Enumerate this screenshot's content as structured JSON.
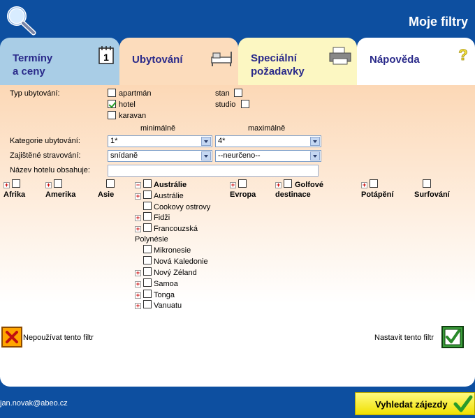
{
  "header": {
    "title": "Moje filtry",
    "logo_icon": "magnifier-icon"
  },
  "tabs": [
    {
      "label_line1": "Termíny",
      "label_line2": "a ceny",
      "icon": "calendar-icon",
      "color": "#a9cde6"
    },
    {
      "label_line1": "Ubytování",
      "label_line2": "",
      "icon": "bed-icon",
      "color": "#fcdcbc",
      "active": true
    },
    {
      "label_line1": "Speciální",
      "label_line2": "požadavky",
      "icon": "printer-icon",
      "color": "#fcf7c2"
    },
    {
      "label_line1": "Nápověda",
      "label_line2": "",
      "icon": "question-icon",
      "color": "#ffffff"
    }
  ],
  "form": {
    "typ_label": "Typ ubytování:",
    "typ_options": [
      {
        "label": "apartmán",
        "checked": false
      },
      {
        "label": "hotel",
        "checked": true
      },
      {
        "label": "karavan",
        "checked": false
      },
      {
        "label": "stan",
        "checked": false
      },
      {
        "label": "studio",
        "checked": false
      }
    ],
    "min_label": "minimálně",
    "max_label": "maximálně",
    "kategorie_label": "Kategorie ubytování:",
    "kategorie_min": "1*",
    "kategorie_max": "4*",
    "strava_label": "Zajištěné stravování:",
    "strava_min": "snídaně",
    "strava_max": "--neurčeno--",
    "hotel_label": "Název hotelu obsahuje:",
    "hotel_value": ""
  },
  "destinations": {
    "afrika": "Afrika",
    "amerika": "Amerika",
    "asie": "Asie",
    "australie": "Austrálie",
    "evropa": "Evropa",
    "golf_1": "Golfové",
    "golf_2": "destinace",
    "potapeni": "Potápění",
    "surfovani": "Surfování",
    "australie_children": {
      "australie": "Austrálie",
      "cookovy": "Cookovy ostrovy",
      "fidzi": "Fidži",
      "polynesie_1": "Francouzská",
      "polynesie_2": "Polynésie",
      "mikronesie": "Mikronesie",
      "nova_kaledonie": "Nová Kaledonie",
      "novy_zeland": "Nový Zéland",
      "samoa": "Samoa",
      "tonga": "Tonga",
      "vanuatu": "Vanuatu"
    }
  },
  "actions": {
    "cancel_label": "Nepoužívat tento filtr",
    "apply_label": "Nastavit tento filtr"
  },
  "footer": {
    "email": "jan.novak@abeo.cz",
    "search_label": "Vyhledat zájezdy"
  }
}
